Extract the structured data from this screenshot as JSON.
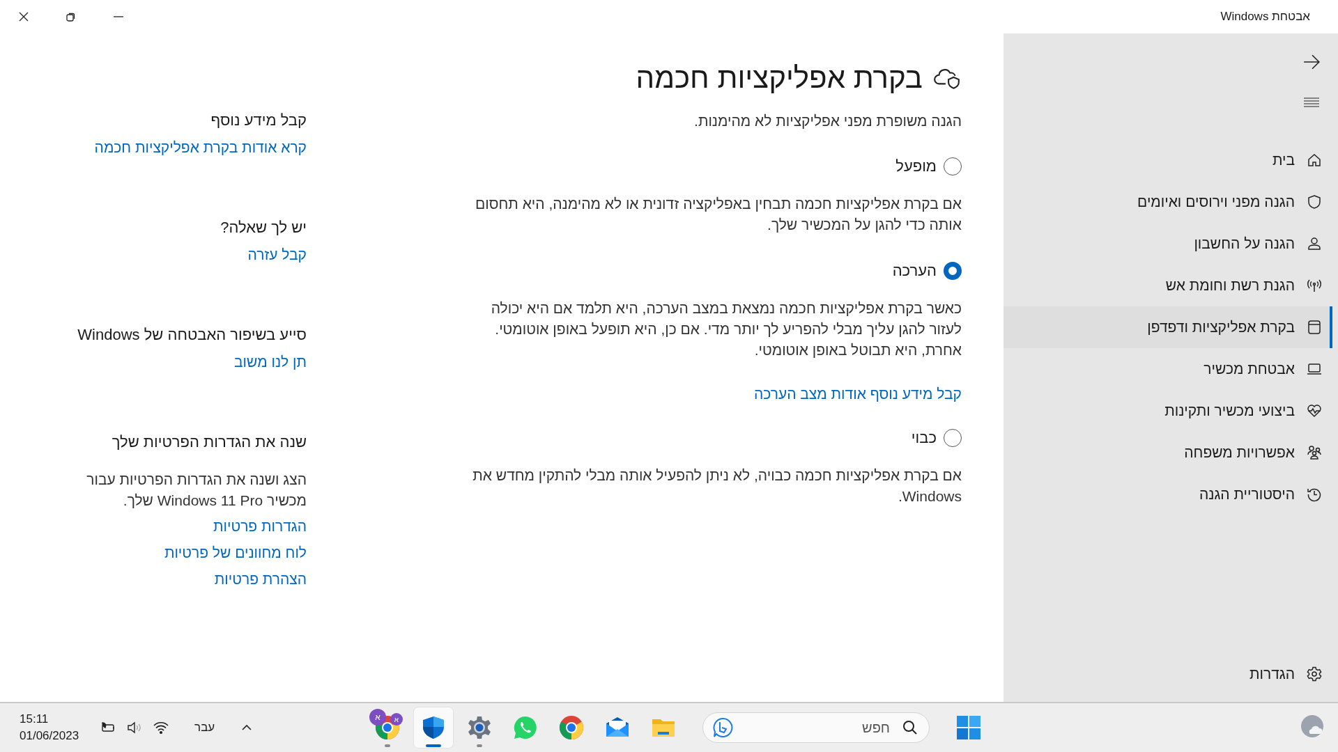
{
  "window": {
    "title": "אבטחת Windows"
  },
  "sidebar": {
    "items": [
      {
        "label": "בית",
        "selected": false
      },
      {
        "label": "הגנה מפני וירוסים ואיומים",
        "selected": false
      },
      {
        "label": "הגנה על החשבון",
        "selected": false
      },
      {
        "label": "הגנת רשת וחומת אש",
        "selected": false
      },
      {
        "label": "בקרת אפליקציות ודפדפן",
        "selected": true
      },
      {
        "label": "אבטחת מכשיר",
        "selected": false
      },
      {
        "label": "ביצועי מכשיר ותקינות",
        "selected": false
      },
      {
        "label": "אפשרויות משפחה",
        "selected": false
      },
      {
        "label": "היסטוריית הגנה",
        "selected": false
      }
    ],
    "settings": "הגדרות"
  },
  "page": {
    "title": "בקרת אפליקציות חכמה",
    "subtitle": "הגנה משופרת מפני אפליקציות לא מהימנות.",
    "options": [
      {
        "label": "מופעל",
        "selected": false,
        "description": "אם בקרת אפליקציות חכמה תבחין באפליקציה זדונית או לא מהימנה, היא תחסום אותה כדי להגן על המכשיר שלך."
      },
      {
        "label": "הערכה",
        "selected": true,
        "description": "כאשר בקרת אפליקציות חכמה נמצאת במצב הערכה, היא תלמד אם היא יכולה לעזור להגן עליך מבלי להפריע לך יותר מדי. אם כן, היא תופעל באופן אוטומטי. אחרת, היא תבוטל באופן אוטומטי.",
        "link": "קבל מידע נוסף אודות מצב הערכה"
      },
      {
        "label": "כבוי",
        "selected": false,
        "description": "אם בקרת אפליקציות חכמה כבויה, לא ניתן להפעיל אותה מבלי להתקין מחדש את Windows."
      }
    ]
  },
  "help": {
    "sections": [
      {
        "heading": "קבל מידע נוסף",
        "links": [
          "קרא אודות בקרת אפליקציות חכמה"
        ]
      },
      {
        "heading": "יש לך שאלה?",
        "links": [
          "קבל עזרה"
        ]
      },
      {
        "heading": "סייע בשיפור האבטחה של Windows",
        "links": [
          "תן לנו משוב"
        ]
      },
      {
        "heading": "שנה את הגדרות הפרטיות שלך",
        "body": "הצג ושנה את הגדרות הפרטיות עבור מכשיר Windows 11 Pro שלך.",
        "links": [
          "הגדרות פרטיות",
          "לוח מחוונים של פרטיות",
          "הצהרת פרטיות"
        ]
      }
    ]
  },
  "taskbar": {
    "time": "15:11",
    "date": "01/06/2023",
    "language": "עבר",
    "apps": [
      {
        "badges": [
          "א",
          "א"
        ],
        "running": true,
        "active": false
      },
      {
        "running": true,
        "active": true
      },
      {
        "running": true,
        "active": false
      },
      {
        "running": false,
        "active": false
      },
      {
        "running": false,
        "active": false
      },
      {
        "running": false,
        "active": false
      },
      {
        "running": false,
        "active": false
      }
    ],
    "search": {
      "placeholder": "חפש"
    }
  }
}
